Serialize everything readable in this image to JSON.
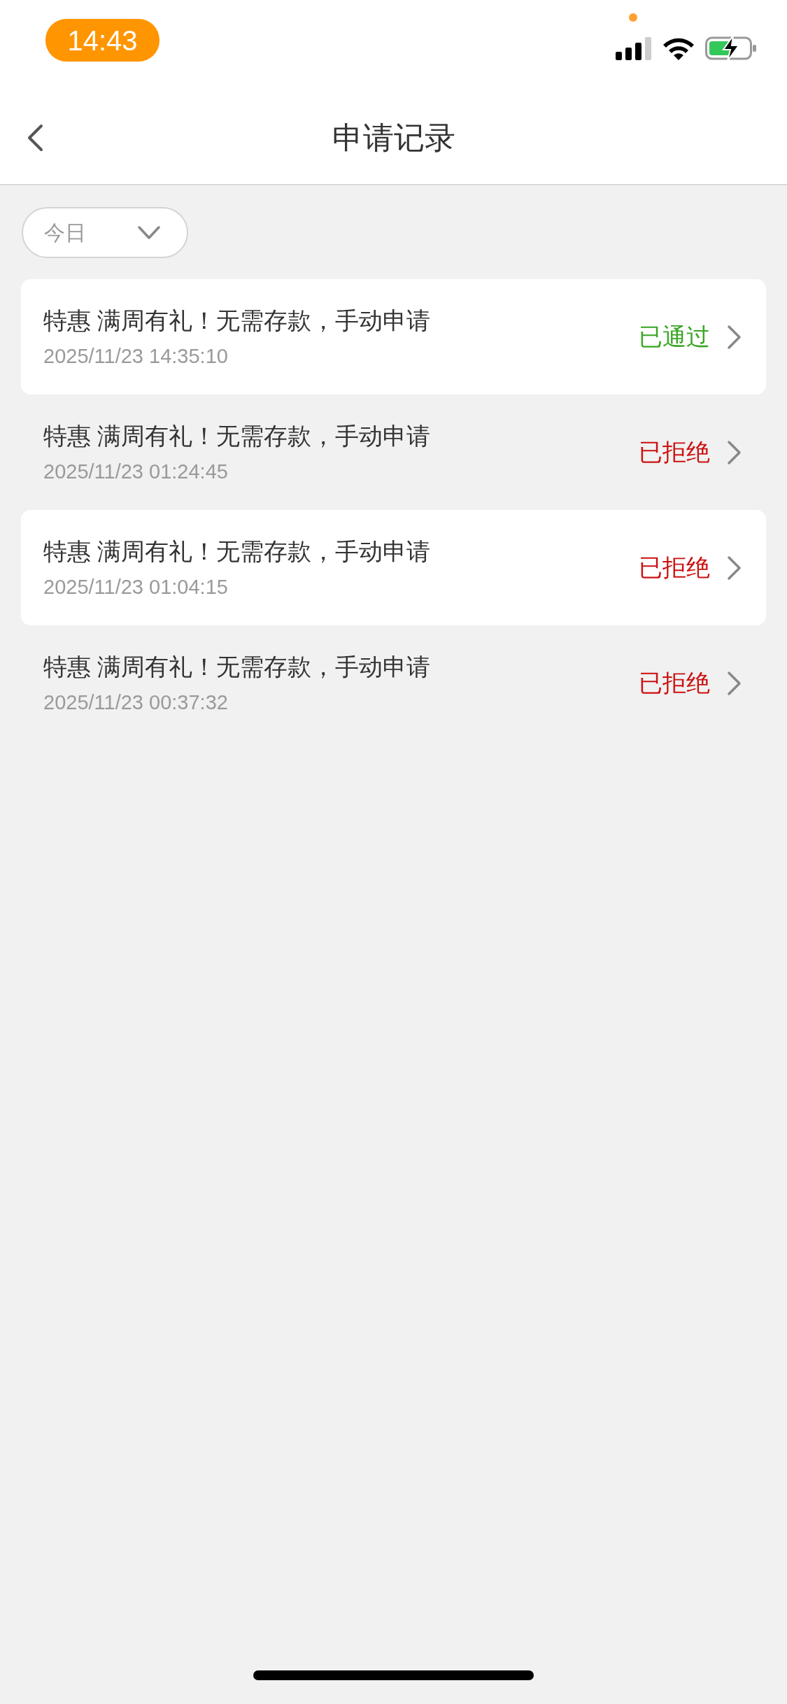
{
  "status_bar": {
    "time": "14:43"
  },
  "header": {
    "title": "申请记录"
  },
  "filter": {
    "label": "今日"
  },
  "records": [
    {
      "title": "特惠 满周有礼！无需存款，手动申请",
      "time": "2025/11/23 14:35:10",
      "status": "已通过",
      "kind": "approved"
    },
    {
      "title": "特惠 满周有礼！无需存款，手动申请",
      "time": "2025/11/23 01:24:45",
      "status": "已拒绝",
      "kind": "rejected"
    },
    {
      "title": "特惠 满周有礼！无需存款，手动申请",
      "time": "2025/11/23 01:04:15",
      "status": "已拒绝",
      "kind": "rejected"
    },
    {
      "title": "特惠 满周有礼！无需存款，手动申请",
      "time": "2025/11/23 00:37:32",
      "status": "已拒绝",
      "kind": "rejected"
    }
  ]
}
